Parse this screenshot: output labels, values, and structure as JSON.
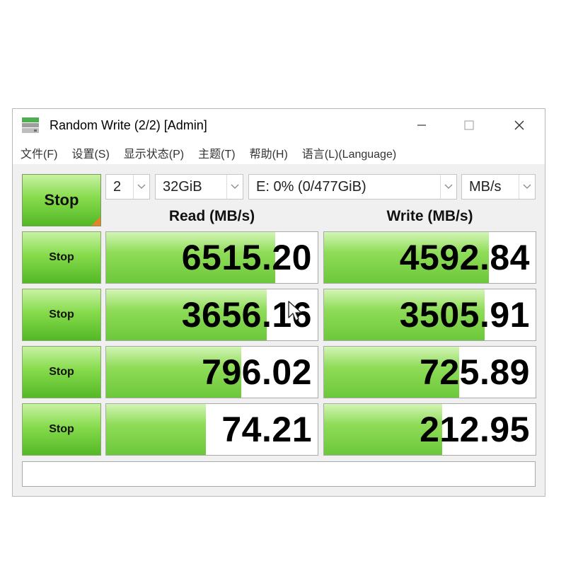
{
  "window": {
    "title": "Random Write (2/2) [Admin]",
    "icon": "disk-drive-icon",
    "controls": [
      "minimize-icon",
      "maximize-icon",
      "close-icon"
    ]
  },
  "menu": [
    {
      "label": "文件(F)"
    },
    {
      "label": "设置(S)"
    },
    {
      "label": "显示状态(P)"
    },
    {
      "label": "主题(T)"
    },
    {
      "label": "帮助(H)"
    },
    {
      "label": "语言(L)(Language)"
    }
  ],
  "controls": {
    "main_button": "Stop",
    "count": "2",
    "size": "32GiB",
    "drive": "E: 0% (0/477GiB)",
    "unit": "MB/s"
  },
  "headers": {
    "read": "Read (MB/s)",
    "write": "Write (MB/s)"
  },
  "rows": [
    {
      "button": "Stop",
      "read": "6515.20",
      "read_fill": 0.8,
      "write": "4592.84",
      "write_fill": 0.78
    },
    {
      "button": "Stop",
      "read": "3656.16",
      "read_fill": 0.76,
      "write": "3505.91",
      "write_fill": 0.76
    },
    {
      "button": "Stop",
      "read": "796.02",
      "read_fill": 0.64,
      "write": "725.89",
      "write_fill": 0.64
    },
    {
      "button": "Stop",
      "read": "74.21",
      "read_fill": 0.47,
      "write": "212.95",
      "write_fill": 0.56
    }
  ],
  "status": "",
  "colors": {
    "bar_green": "#6cc83a",
    "button_green": "#86db4c",
    "corner_orange": "#e8812a"
  }
}
